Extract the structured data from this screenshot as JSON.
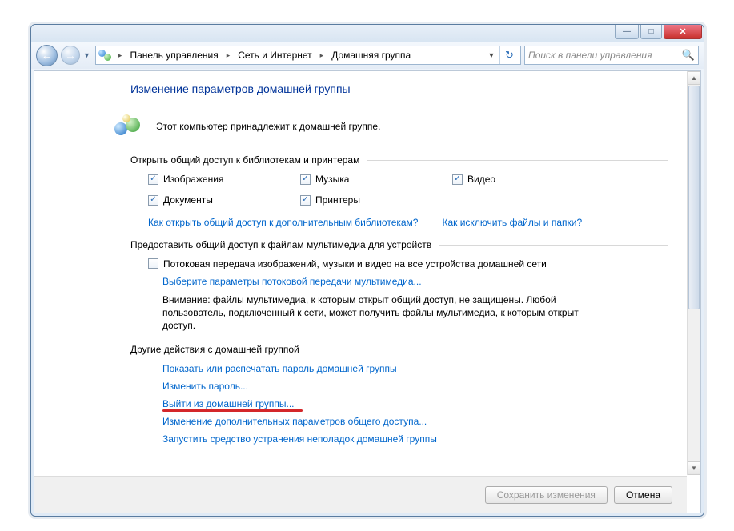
{
  "window": {
    "minimize_glyph": "—",
    "maximize_glyph": "□",
    "close_glyph": "✕"
  },
  "nav": {
    "back_glyph": "←",
    "forward_glyph": "→",
    "dropdown_glyph": "▼",
    "refresh_glyph": "↻"
  },
  "breadcrumb": {
    "sep": "▸",
    "items": [
      "Панель управления",
      "Сеть и Интернет",
      "Домашняя группа"
    ]
  },
  "search": {
    "placeholder": "Поиск в панели управления",
    "icon_glyph": "🔍"
  },
  "page": {
    "title": "Изменение параметров домашней группы",
    "intro": "Этот компьютер принадлежит к домашней группе."
  },
  "libs_section": {
    "title": "Открыть общий доступ к библиотекам и принтерам",
    "check_glyph": "✓",
    "items": [
      {
        "label": "Изображения",
        "checked": true
      },
      {
        "label": "Музыка",
        "checked": true
      },
      {
        "label": "Видео",
        "checked": true
      },
      {
        "label": "Документы",
        "checked": true
      },
      {
        "label": "Принтеры",
        "checked": true
      }
    ],
    "link_more_libs": "Как открыть общий доступ к дополнительным библиотекам?",
    "link_exclude": "Как исключить файлы и папки?"
  },
  "media_section": {
    "title": "Предоставить общий доступ к файлам мультимедиа для устройств",
    "stream_checkbox": "Потоковая передача изображений, музыки и видео на все устройства домашней сети",
    "stream_checked": false,
    "stream_link": "Выберите параметры потоковой передачи мультимедиа...",
    "warning": "Внимание: файлы мультимедиа, к которым открыт общий доступ, не защищены. Любой пользователь, подключенный к сети, может получить файлы мультимедиа, к которым открыт доступ."
  },
  "other_section": {
    "title": "Другие действия с домашней группой",
    "links": [
      "Показать или распечатать пароль домашней группы",
      "Изменить пароль...",
      "Выйти из домашней группы...",
      "Изменение дополнительных параметров общего доступа...",
      "Запустить средство устранения неполадок домашней группы"
    ]
  },
  "footer": {
    "save": "Сохранить изменения",
    "cancel": "Отмена"
  },
  "scrollbar": {
    "up": "▲",
    "down": "▼"
  }
}
